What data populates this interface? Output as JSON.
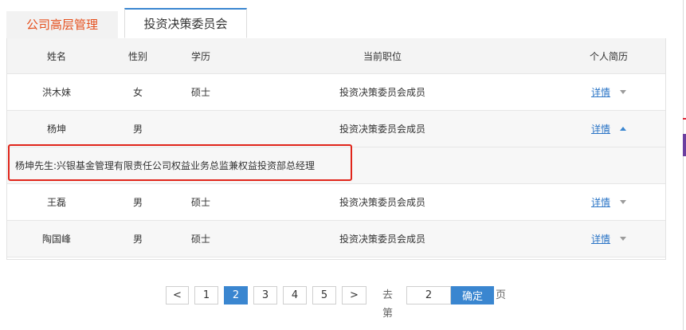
{
  "tabs": [
    {
      "label": "公司高层管理"
    },
    {
      "label": "投资决策委员会"
    }
  ],
  "table": {
    "headers": {
      "name": "姓名",
      "gender": "性别",
      "education": "学历",
      "position": "当前职位",
      "bio": "个人简历"
    },
    "rows": [
      {
        "name": "洪木妹",
        "gender": "女",
        "education": "硕士",
        "position": "投资决策委员会成员",
        "bio": "详情"
      },
      {
        "name": "杨坤",
        "gender": "男",
        "education": "",
        "position": "投资决策委员会成员",
        "bio": "详情"
      },
      {
        "name": "王磊",
        "gender": "男",
        "education": "硕士",
        "position": "投资决策委员会成员",
        "bio": "详情"
      },
      {
        "name": "陶国峰",
        "gender": "男",
        "education": "硕士",
        "position": "投资决策委员会成员",
        "bio": "详情"
      }
    ],
    "expanded_text": "杨坤先生:兴银基金管理有限责任公司权益业务总监兼权益投资部总经理"
  },
  "pagination": {
    "prev": "<",
    "pages": [
      "1",
      "2",
      "3",
      "4",
      "5"
    ],
    "current": "2",
    "next": ">",
    "goto_prefix": "去第",
    "goto_value": "2",
    "confirm": "确定",
    "goto_suffix": "页"
  },
  "colors": {
    "accent": "#3a86d0",
    "tab_inactive_text": "#e5501e",
    "highlight_border": "#e0251a"
  }
}
